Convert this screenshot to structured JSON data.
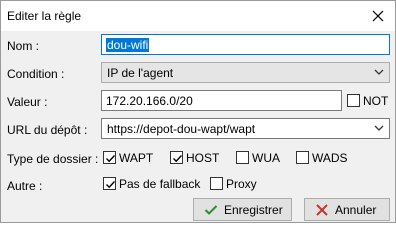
{
  "window": {
    "title": "Editer la règle",
    "close_icon": "close-icon"
  },
  "form": {
    "nom": {
      "label": "Nom :",
      "value": "dou-wifi"
    },
    "condition": {
      "label": "Condition :",
      "value": "IP de l'agent"
    },
    "valeur": {
      "label": "Valeur :",
      "value": "172.20.166.0/20",
      "not_label": "NOT",
      "not_checked": false
    },
    "url": {
      "label": "URL du dépôt :",
      "value": "https://depot-dou-wapt/wapt"
    },
    "type_dossier": {
      "label": "Type de dossier :",
      "options": [
        {
          "label": "WAPT",
          "checked": true
        },
        {
          "label": "HOST",
          "checked": true
        },
        {
          "label": "WUA",
          "checked": false
        },
        {
          "label": "WADS",
          "checked": false
        }
      ]
    },
    "autre": {
      "label": "Autre :",
      "options": [
        {
          "label": "Pas de fallback",
          "checked": true
        },
        {
          "label": "Proxy",
          "checked": false
        }
      ]
    }
  },
  "buttons": {
    "save": {
      "label": "Enregistrer",
      "icon": "check-icon"
    },
    "cancel": {
      "label": "Annuler",
      "icon": "cross-icon"
    }
  },
  "colors": {
    "selection": "#0078d7",
    "save_icon": "#2e8b2e",
    "cancel_icon": "#c0392b"
  }
}
